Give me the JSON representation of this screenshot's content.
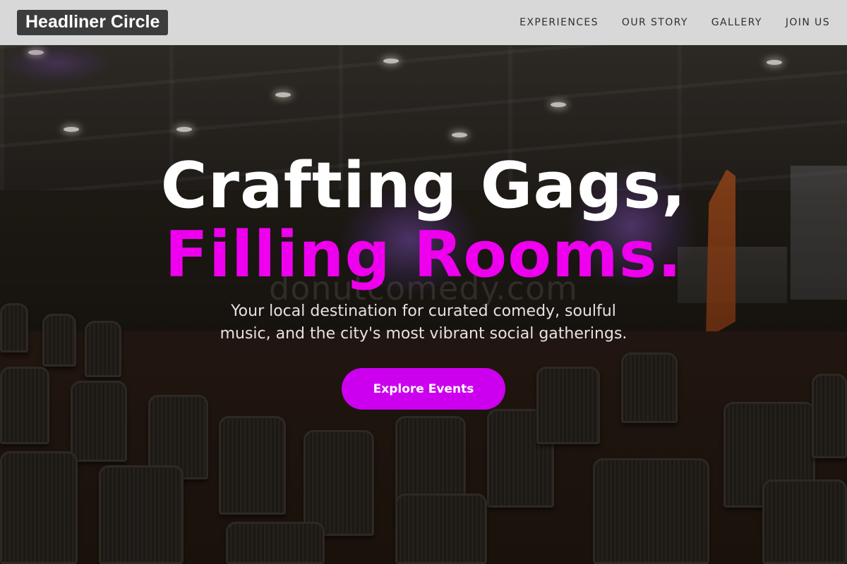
{
  "site": {
    "brand": "Headliner Circle"
  },
  "nav": {
    "items": [
      {
        "label": "EXPERIENCES"
      },
      {
        "label": "OUR STORY"
      },
      {
        "label": "GALLERY"
      },
      {
        "label": "JOIN US"
      }
    ]
  },
  "hero": {
    "headline_line1": "Crafting Gags,",
    "headline_line2": "Filling Rooms.",
    "subtitle_line1": "Your local destination for curated comedy, soulful",
    "subtitle_line2": "music, and the city's most vibrant social gatherings.",
    "cta_label": "Explore Events",
    "watermark": "donutcomedy.com",
    "background": "dim conference room with rows of stacking chairs and purple uplighting"
  },
  "colors": {
    "accent": "#ee00ee",
    "button": "#cc00ee",
    "nav_background": "#d9d8d8",
    "brand_background": "#3c3c3c"
  }
}
